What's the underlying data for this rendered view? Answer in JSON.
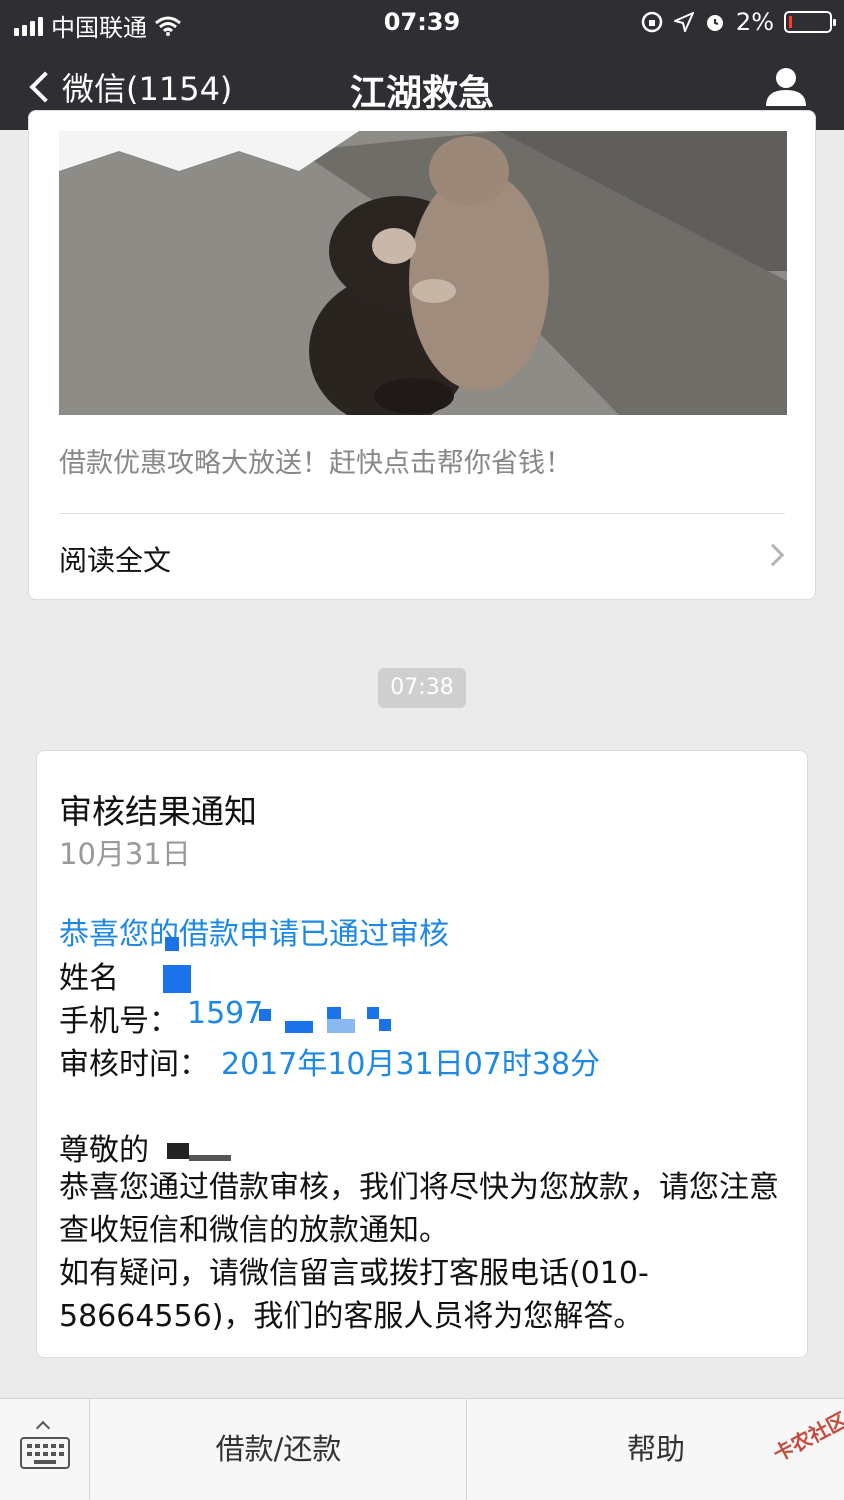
{
  "status_bar": {
    "carrier": "中国联通",
    "time": "07:39",
    "battery_percent": "2%"
  },
  "nav": {
    "back_label": "微信(1154)",
    "title": "江湖救急"
  },
  "article_card": {
    "description": "借款优惠攻略大放送！赶快点击帮你省钱！",
    "read_more": "阅读全文"
  },
  "timestamp": "07:38",
  "notice": {
    "title": "审核结果通知",
    "date": "10月31日",
    "headline": "恭喜您的借款申请已通过审核",
    "name_label": "姓名",
    "phone_label": "手机号：",
    "phone_value": "1597",
    "time_label": "审核时间：",
    "time_value": "2017年10月31日07时38分",
    "greeting": "尊敬的",
    "body_1": "恭喜您通过借款审核，我们将尽快为您放款，请您注意查收短信和微信的放款通知。",
    "body_2": "如有疑问，请微信留言或拨打客服电话(010-58664556)，我们的客服人员将为您解答。"
  },
  "bottom_menu": {
    "item_1": "借款/还款",
    "item_2": "帮助"
  },
  "watermark": "卡农社区",
  "colors": {
    "nav_bg": "#2e2e33",
    "link_blue": "#1e88e5",
    "page_bg": "#ebebeb"
  }
}
